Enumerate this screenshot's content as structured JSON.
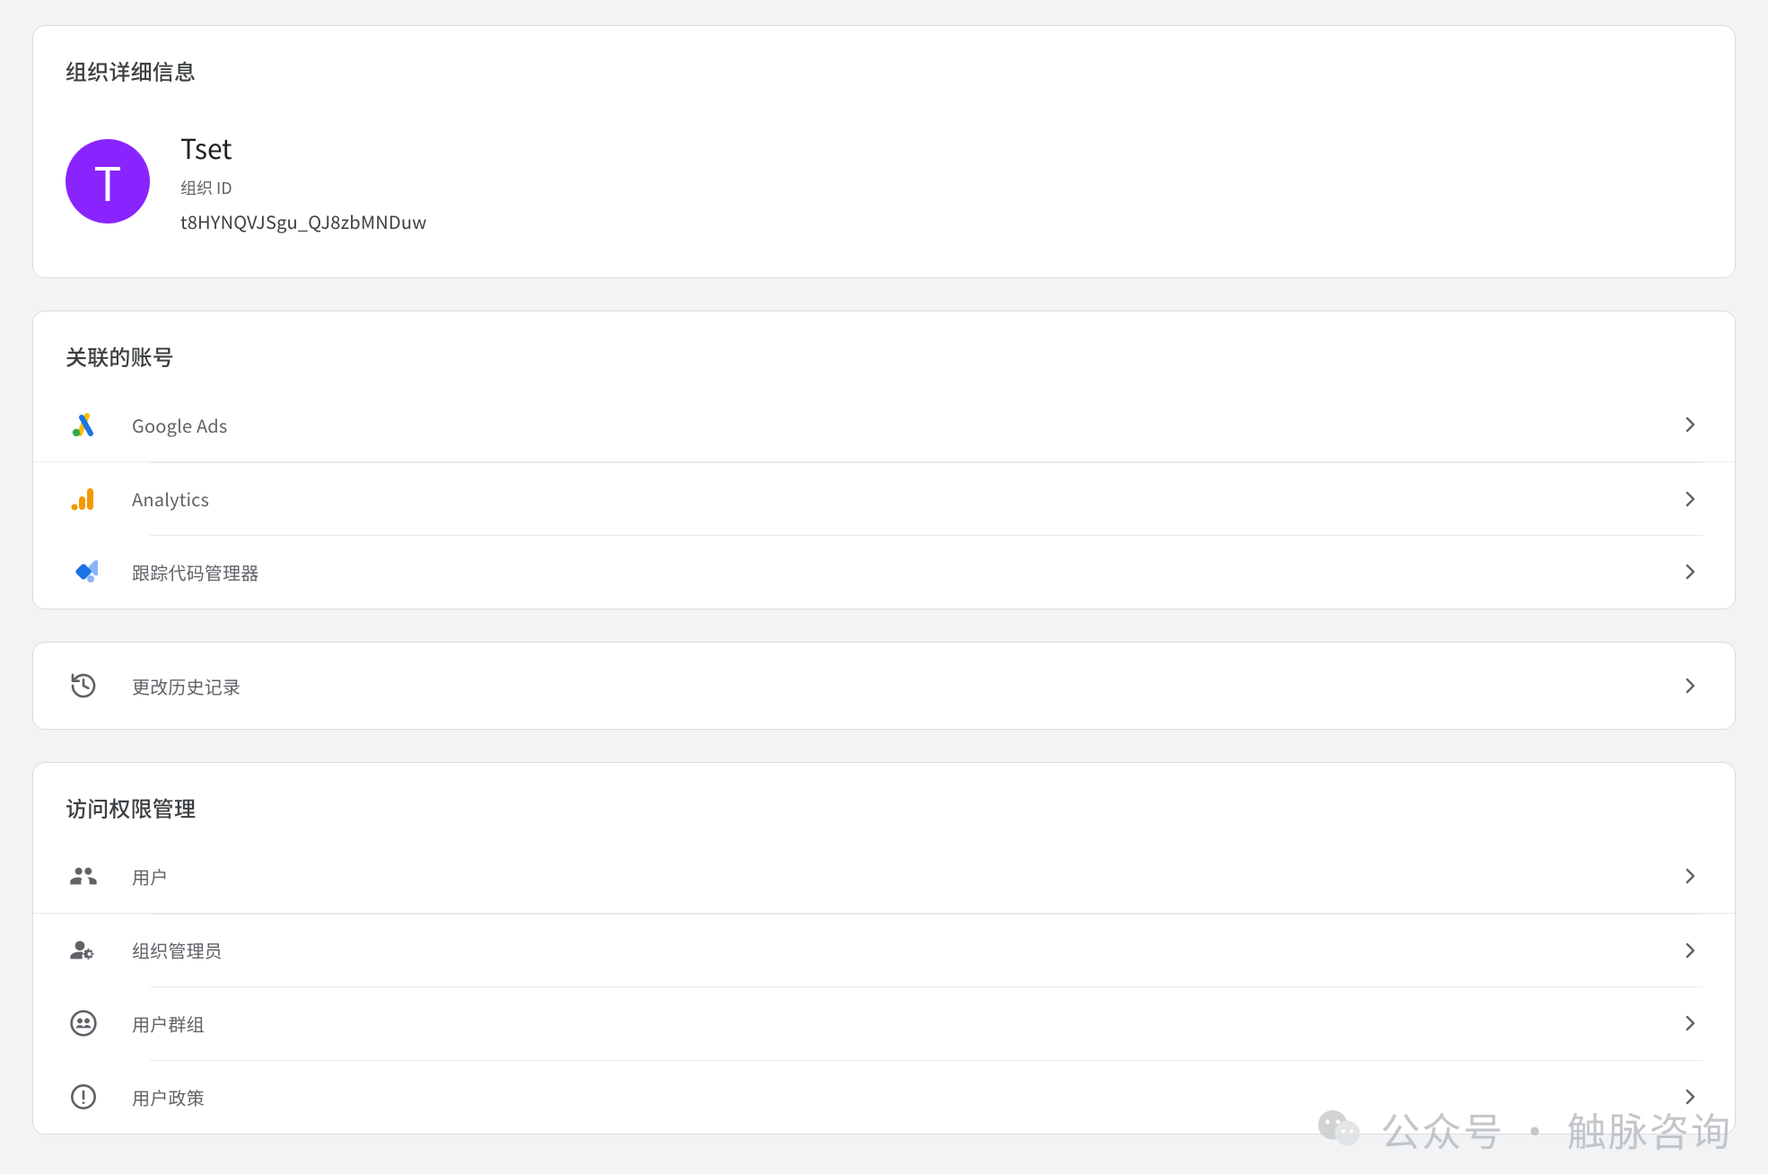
{
  "org_details": {
    "section_title": "组织详细信息",
    "avatar_letter": "T",
    "name": "Tset",
    "id_label": "组织 ID",
    "id": "t8HYNQVJSgu_QJ8zbMNDuw"
  },
  "linked_accounts": {
    "section_title": "关联的账号",
    "items": [
      {
        "icon": "google-ads-icon",
        "label": "Google Ads"
      },
      {
        "icon": "analytics-icon",
        "label": "Analytics"
      },
      {
        "icon": "gtm-icon",
        "label": "跟踪代码管理器"
      }
    ]
  },
  "change_history": {
    "label": "更改历史记录"
  },
  "access_management": {
    "section_title": "访问权限管理",
    "items": [
      {
        "icon": "users-icon",
        "label": "用户"
      },
      {
        "icon": "admin-icon",
        "label": "组织管理员"
      },
      {
        "icon": "groups-icon",
        "label": "用户群组"
      },
      {
        "icon": "policy-icon",
        "label": "用户政策"
      }
    ]
  },
  "watermark": {
    "text": "公众号 · 触脉咨询"
  }
}
